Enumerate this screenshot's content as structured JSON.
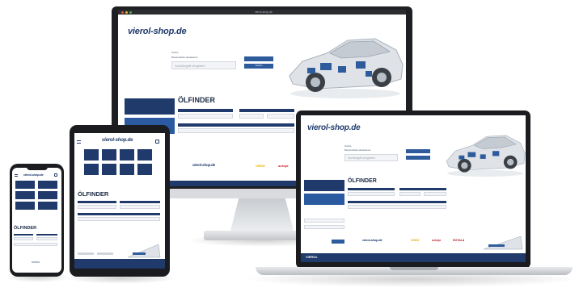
{
  "shop": {
    "logo_text": "vierol-shop.de",
    "search_heading": "Suche",
    "search_checkbox_label": "Bestandsdaten aktualisieren",
    "search_placeholder": "Suchbegriff eingeben",
    "search_button": "Suchen",
    "oel_finder_title": "ÖLFINDER",
    "brands": [
      "vierol",
      "VEMO",
      "ackoja",
      "ROTALA"
    ],
    "footer_logo": "VIEROL"
  },
  "monitor": {
    "os_title": "vierol-shop.de"
  },
  "colors": {
    "brand_navy": "#1f3a6b",
    "brand_blue": "#2e5b9c",
    "vemo_yellow": "#e0b300",
    "ackoja_red": "#c8202a",
    "rotala_red": "#b3161f"
  },
  "icons": [
    "car-illustration",
    "menu-icon",
    "cart-icon",
    "user-icon",
    "search-icon"
  ]
}
